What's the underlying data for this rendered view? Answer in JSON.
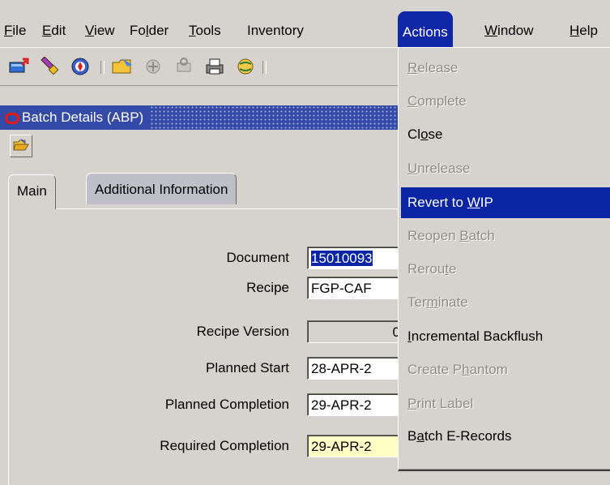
{
  "menubar": {
    "items": [
      {
        "pre": "",
        "ul": "F",
        "post": "ile"
      },
      {
        "pre": "",
        "ul": "E",
        "post": "dit"
      },
      {
        "pre": "",
        "ul": "V",
        "post": "iew"
      },
      {
        "pre": "Fo",
        "ul": "l",
        "post": "der"
      },
      {
        "pre": "",
        "ul": "T",
        "post": "ools"
      },
      {
        "pre": "Inventory",
        "ul": "",
        "post": ""
      },
      {
        "pre": "Actions",
        "ul": "",
        "post": ""
      },
      {
        "pre": "",
        "ul": "W",
        "post": "indow"
      },
      {
        "pre": "",
        "ul": "H",
        "post": "elp"
      }
    ]
  },
  "toolbar": {
    "icons": [
      "new-record-icon",
      "flashlight-icon",
      "navigate-icon",
      "save-folder-icon",
      "switch-icon",
      "printer-attach-icon",
      "print-icon",
      "globe-icon"
    ]
  },
  "window": {
    "title": "Batch Details (ABP)"
  },
  "tabs": {
    "main": "Main",
    "additional": "Additional Information"
  },
  "form": {
    "document_label": "Document",
    "document_value": "15010093",
    "recipe_label": "Recipe",
    "recipe_value": "FGP-CAF",
    "recipe_version_label": "Recipe Version",
    "recipe_version_value": "0",
    "planned_start_label": "Planned Start",
    "planned_start_value": "28-APR-2",
    "planned_completion_label": "Planned Completion",
    "planned_completion_value": "29-APR-2",
    "required_completion_label": "Required Completion",
    "required_completion_value": "29-APR-2"
  },
  "actions_menu": {
    "items": [
      {
        "pre": "",
        "ul": "R",
        "post": "elease",
        "state": "disabled"
      },
      {
        "pre": "",
        "ul": "C",
        "post": "omplete",
        "state": "disabled"
      },
      {
        "pre": "Cl",
        "ul": "o",
        "post": "se",
        "state": "enabled"
      },
      {
        "pre": "",
        "ul": "U",
        "post": "nrelease",
        "state": "disabled"
      },
      {
        "pre": "Revert to ",
        "ul": "W",
        "post": "IP",
        "state": "highlight"
      },
      {
        "pre": "Reopen ",
        "ul": "B",
        "post": "atch",
        "state": "disabled"
      },
      {
        "pre": "Rerou",
        "ul": "t",
        "post": "e",
        "state": "disabled"
      },
      {
        "pre": "Ter",
        "ul": "m",
        "post": "inate",
        "state": "disabled"
      },
      {
        "pre": "",
        "ul": "I",
        "post": "ncremental Backflush",
        "state": "enabled"
      },
      {
        "pre": "Create P",
        "ul": "h",
        "post": "antom",
        "state": "disabled"
      },
      {
        "pre": "",
        "ul": "P",
        "post": "rint Label",
        "state": "disabled"
      },
      {
        "pre": "B",
        "ul": "a",
        "post": "tch E-Records",
        "state": "enabled"
      }
    ]
  },
  "colors": {
    "menu_highlight": "#0a24a6",
    "required_field": "#ffffc6",
    "oracle_red": "#e8180c"
  }
}
